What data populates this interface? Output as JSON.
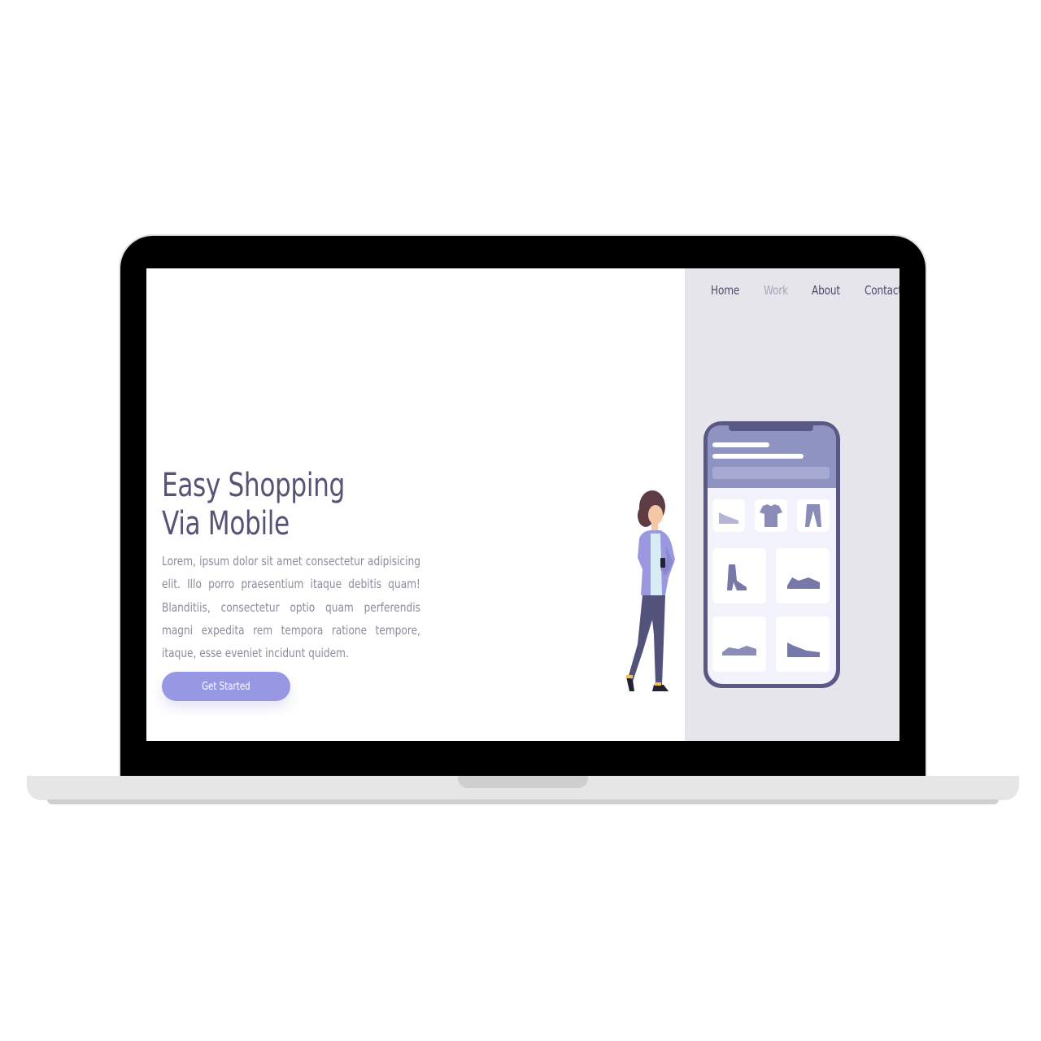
{
  "nav": {
    "items": [
      {
        "label": "Home",
        "active": false
      },
      {
        "label": "Work",
        "active": true
      },
      {
        "label": "About",
        "active": false
      },
      {
        "label": "Contact",
        "active": false
      }
    ]
  },
  "hero": {
    "title_line1": "Easy Shopping",
    "title_line2": "Via Mobile",
    "body": "Lorem, ipsum dolor sit amet consectetur adipisicing elit. Illo porro praesentium itaque debitis quam! Blanditiis, consectetur optio quam perferendis magni expedita rem tempora ratione tempore, itaque, esse eveniet incidunt quidem.",
    "cta_label": "Get Started"
  },
  "colors": {
    "accent": "#9797e3",
    "heading": "#555474",
    "body_text": "#8d8c9c",
    "side_panel": "#e6e5eb",
    "nav_active": "#a6a5b5",
    "phone_frame": "#5a5884"
  },
  "illustration": {
    "icons": [
      "shoe-flat-icon",
      "tshirt-icon",
      "pants-icon",
      "boot-icon",
      "sneaker-icon",
      "sneaker-icon",
      "sneaker-icon"
    ]
  }
}
